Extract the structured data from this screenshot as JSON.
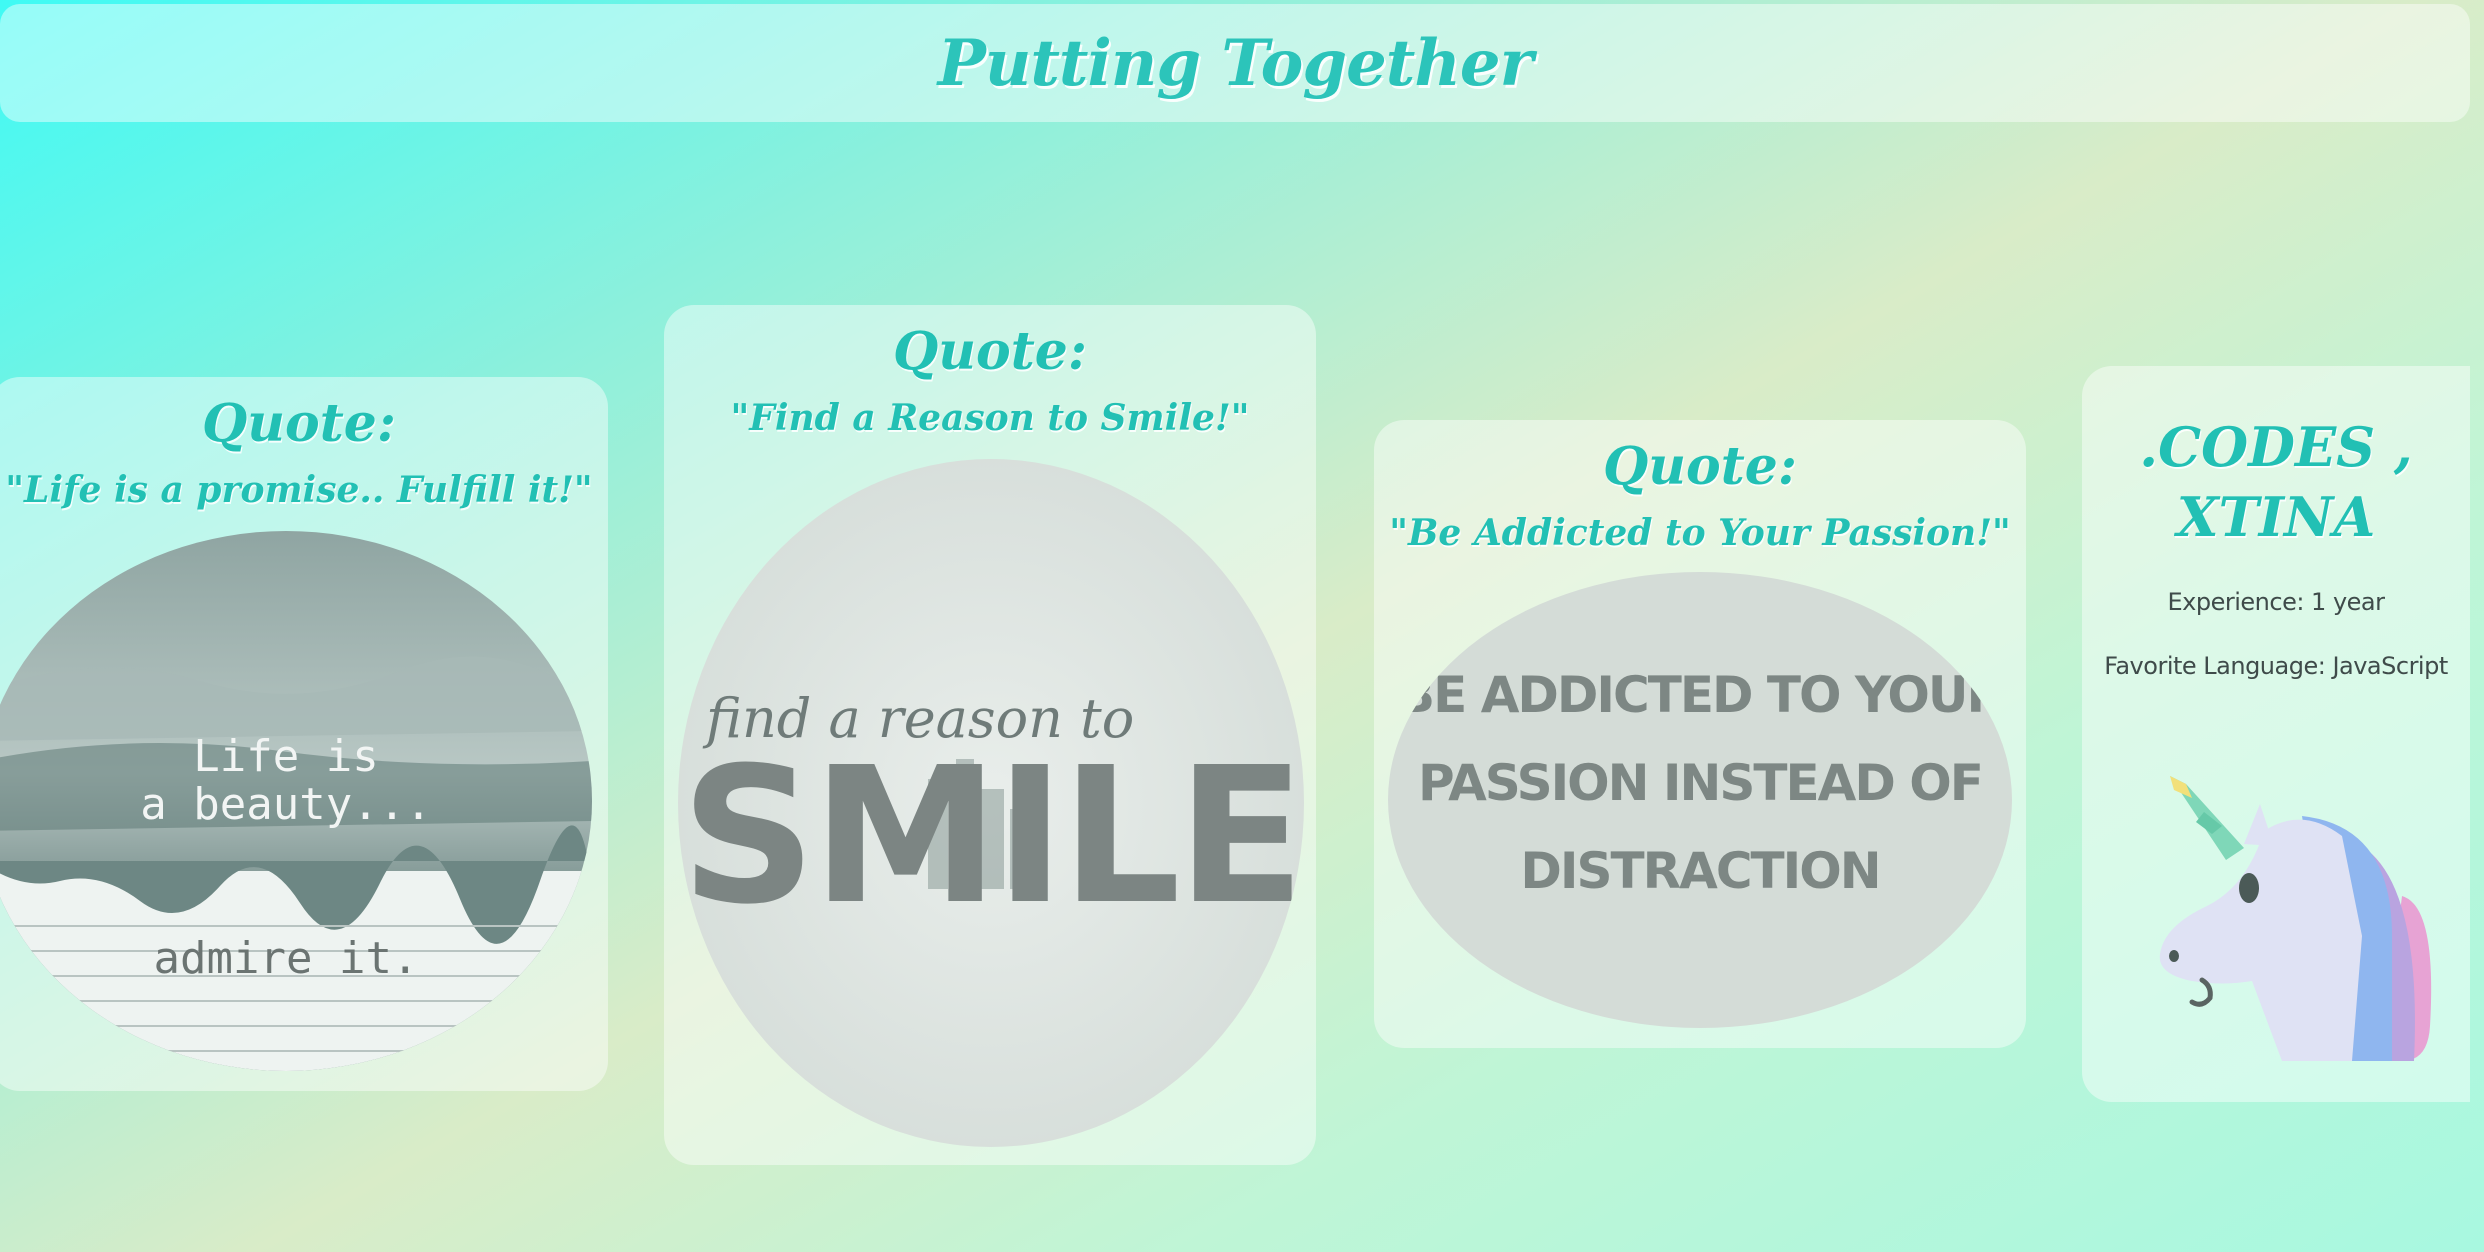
{
  "header": {
    "title": "Putting Together"
  },
  "cards": [
    {
      "heading": "Quote:",
      "quote": "\"Life is a promise.. Fulfill it!\"",
      "image_text": {
        "line1": "Life is",
        "line2": "a beauty...",
        "line3": "admire it."
      }
    },
    {
      "heading": "Quote:",
      "quote": "\"Find a Reason to Smile!\"",
      "image_text": {
        "line1": "find a reason to",
        "line2": "SMILE"
      }
    },
    {
      "heading": "Quote:",
      "quote": "\"Be Addicted to Your Passion!\"",
      "image_text": {
        "line1": "BE ADDICTED TO YOUR",
        "line2": "PASSION INSTEAD OF",
        "line3": "DISTRACTION"
      }
    }
  ],
  "profile": {
    "title_line1": ".CODES ,",
    "title_line2": "XTINA",
    "experience": "Experience: 1 year",
    "language": "Favorite Language: JavaScript",
    "avatar_icon": "unicorn-icon"
  },
  "colors": {
    "accent": "#22c0b4",
    "text": "#3f4b4a"
  }
}
